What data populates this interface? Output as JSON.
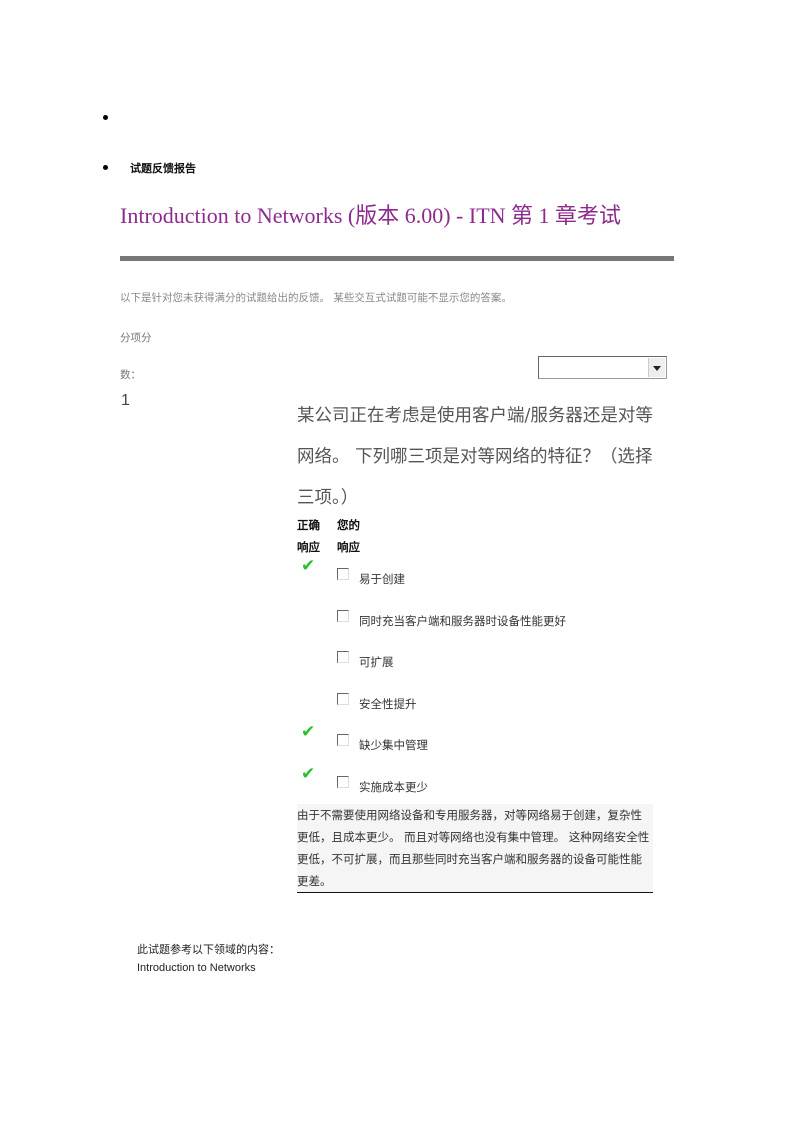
{
  "nav": {
    "report_label": "试题反馈报告"
  },
  "header": {
    "title": "Introduction to Networks (版本  6.00) - ITN  第  1  章考试"
  },
  "intro": "以下是针对您未获得满分的试题给出的反馈。  某些交互式试题可能不显示您的答案。",
  "score": {
    "label_line1": "分项分",
    "label_line2": "数：",
    "select_value": ""
  },
  "question": {
    "number": "1",
    "text": "某公司正在考虑是使用客户端/服务器还是对等网络。  下列哪三项是对等网络的特征？（选择三项。）",
    "col_correct": [
      "正确",
      "响应"
    ],
    "col_yours": [
      "您的",
      "响应"
    ],
    "options": [
      {
        "label": "易于创建",
        "correct": true,
        "selected": false
      },
      {
        "label": "同时充当客户端和服务器时设备性能更好",
        "correct": false,
        "selected": false
      },
      {
        "label": "可扩展",
        "correct": false,
        "selected": false
      },
      {
        "label": "安全性提升",
        "correct": false,
        "selected": false
      },
      {
        "label": "缺少集中管理",
        "correct": true,
        "selected": false
      },
      {
        "label": "实施成本更少",
        "correct": true,
        "selected": false
      }
    ],
    "explanation": "由于不需要使用网络设备和专用服务器，对等网络易于创建，复杂性更低，且成本更少。  而且对等网络也没有集中管理。  这种网络安全性更低，不可扩展，而且那些同时充当客户端和服务器的设备可能性能更差。"
  },
  "reference": {
    "label": "此试题参考以下领域的内容：",
    "link": "Introduction to Networks"
  },
  "colors": {
    "title": "#8e2a8e",
    "check": "#2bbf2b",
    "rule": "#777777"
  }
}
